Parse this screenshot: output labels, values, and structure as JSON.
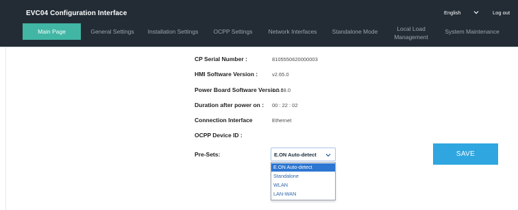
{
  "header": {
    "title": "EVC04 Configuration Interface",
    "language": "English",
    "logout": "Log out"
  },
  "nav": {
    "items": [
      {
        "label": "Main Page",
        "active": true
      },
      {
        "label": "General Settings"
      },
      {
        "label": "Installation Settings"
      },
      {
        "label": "OCPP Settings"
      },
      {
        "label": "Network Interfaces"
      },
      {
        "label": "Standalone Mode"
      },
      {
        "label": "Local Load",
        "label2": "Management"
      },
      {
        "label": "System Maintenance"
      }
    ]
  },
  "info": {
    "rows": [
      {
        "label": "CP Serial Number :",
        "value": "8105550620000003"
      },
      {
        "label": "HMI Software Version :",
        "value": "v2.65.0"
      },
      {
        "label": "Power Board Software Version :",
        "value": "1.0.88.0"
      },
      {
        "label": "Duration after power on :",
        "value": "00 : 22 : 02"
      },
      {
        "label": "Connection Interface",
        "value": "Ethernet"
      },
      {
        "label": "OCPP Device ID :",
        "value": ""
      }
    ]
  },
  "presets": {
    "label": "Pre-Sets:",
    "selected": "E.ON Auto-detect",
    "options": [
      "E.ON Auto-detect",
      "Standalone",
      "WLAN",
      "LAN-WAN"
    ]
  },
  "actions": {
    "save": "SAVE"
  },
  "colors": {
    "header_bg": "#232c35",
    "nav_active": "#41b6a5",
    "save_button": "#2fa6e0",
    "dropdown_highlight": "#2d76d1"
  }
}
